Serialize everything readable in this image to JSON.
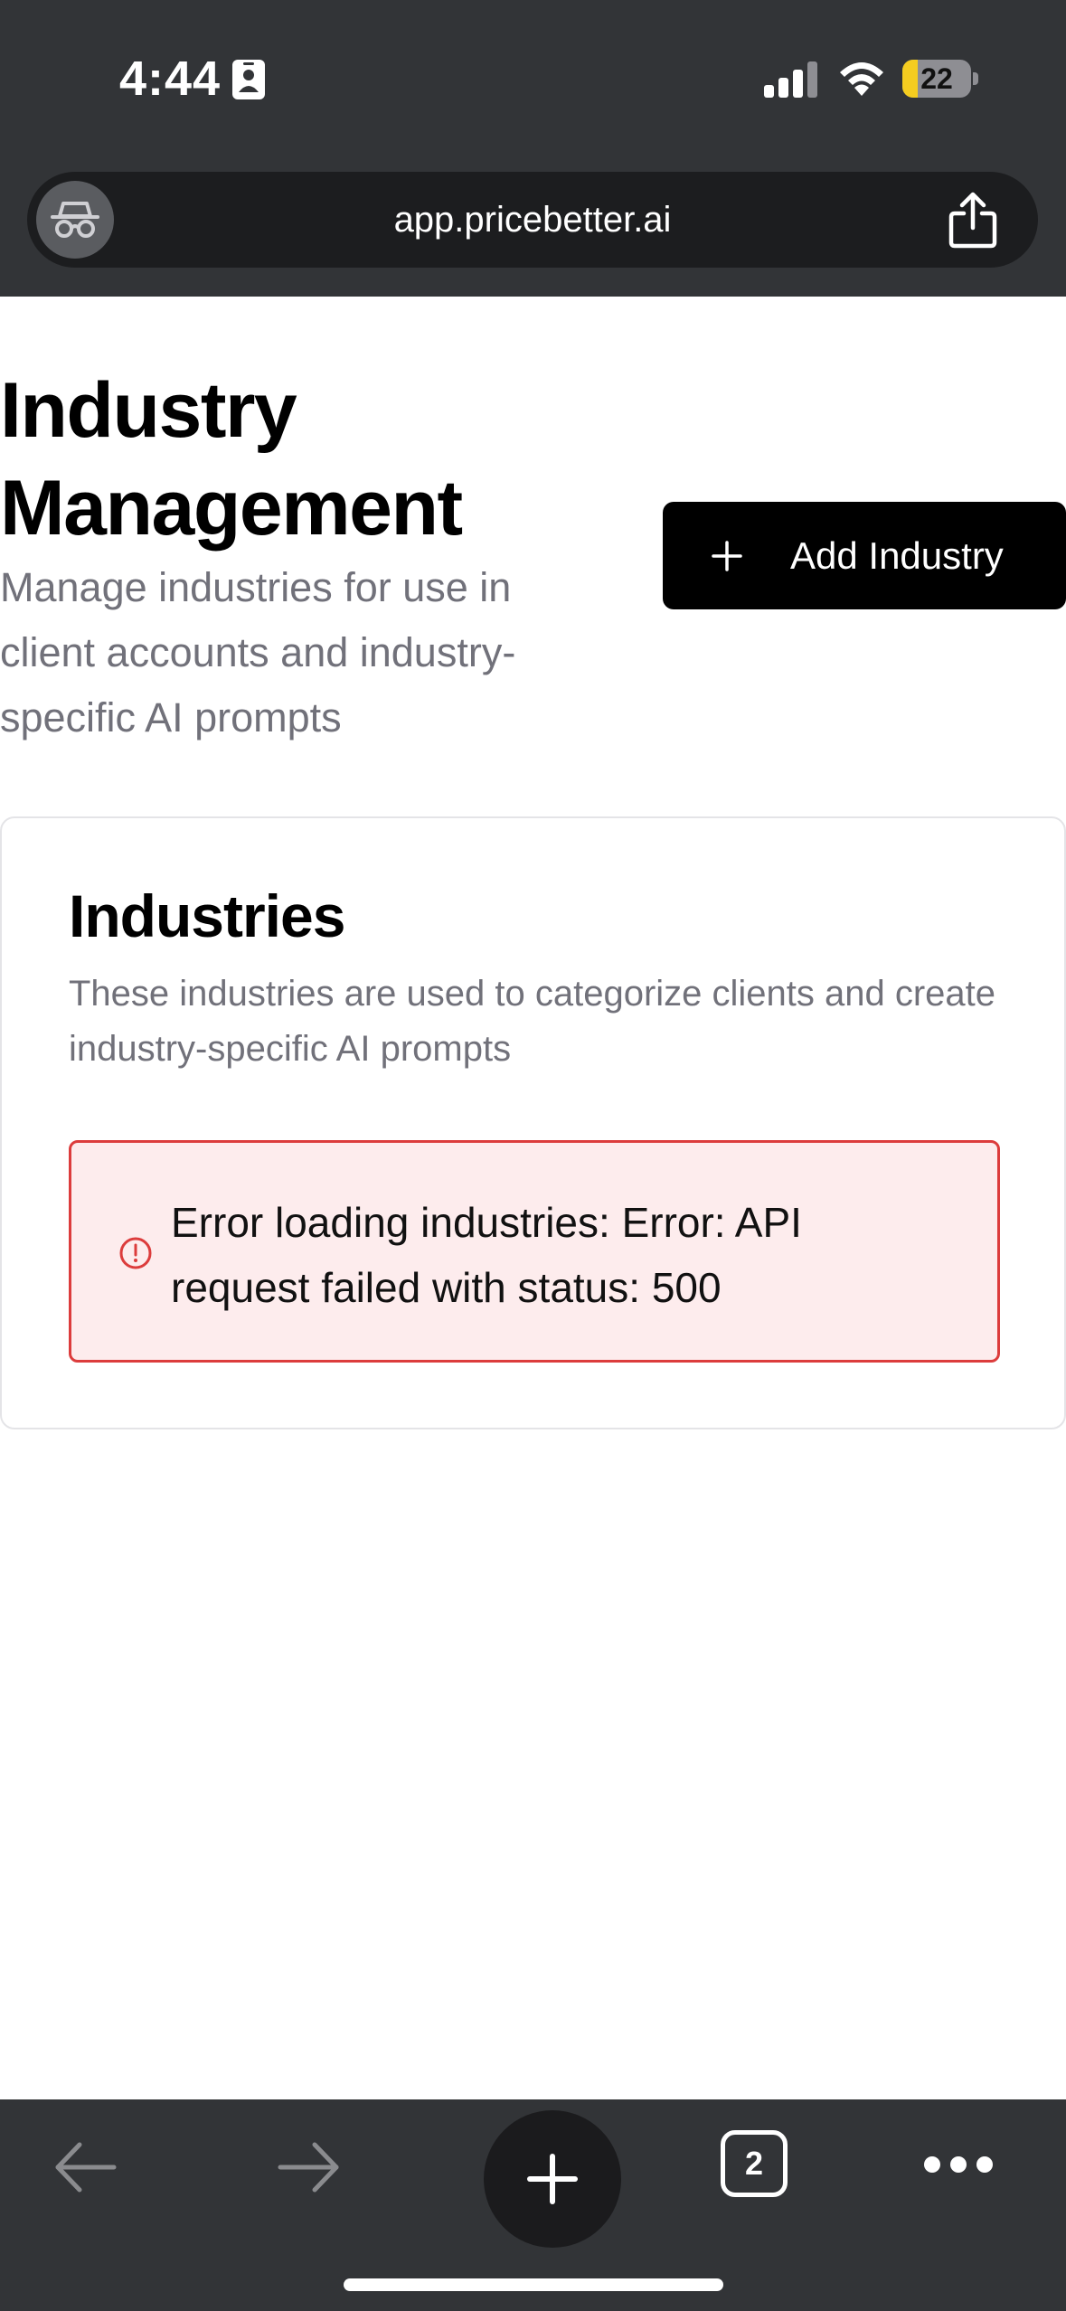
{
  "status_bar": {
    "time": "4:44",
    "battery_level": "22"
  },
  "browser": {
    "url": "app.pricebetter.ai",
    "open_tabs": "2"
  },
  "page": {
    "title": "Industry Management",
    "subtitle": "Manage industries for use in client accounts and industry-specific AI prompts",
    "add_button_label": "Add Industry"
  },
  "card": {
    "title": "Industries",
    "description": "These industries are used to categorize clients and create industry-specific AI prompts",
    "error_message": "Error loading industries: Error: API request failed with status: 500"
  },
  "colors": {
    "chrome_bg": "#323437",
    "error_border": "#dc3c3c",
    "error_bg": "#fdeced",
    "muted_text": "#71717a",
    "battery_fill": "#f5cd20"
  }
}
